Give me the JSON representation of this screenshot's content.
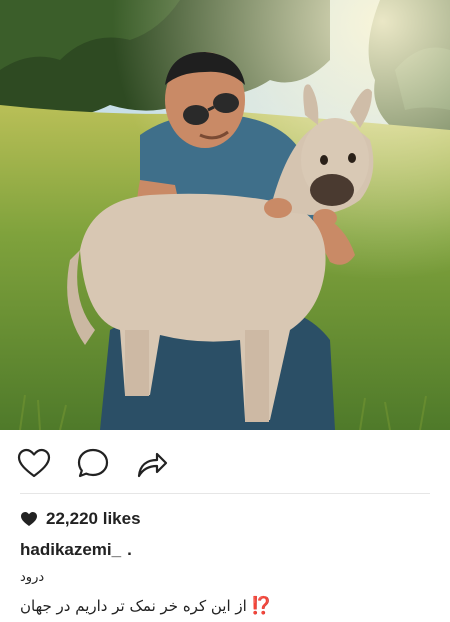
{
  "post": {
    "image_alt": "photo",
    "likes_icon": "heart-filled-icon",
    "likes_text": "22,220 likes",
    "username": "hadikazemi_",
    "username_suffix": ".",
    "caption_line1": "درود",
    "caption_line2": "از این کره خر نمک تر داریم در جهان",
    "caption_emoji": "⁉️"
  },
  "icons": {
    "like": "heart-outline-icon",
    "comment": "comment-bubble-icon",
    "share": "share-arrow-icon"
  },
  "colors": {
    "text": "#222222",
    "divider": "#e6e6e6",
    "emoji": "#e0211c"
  }
}
